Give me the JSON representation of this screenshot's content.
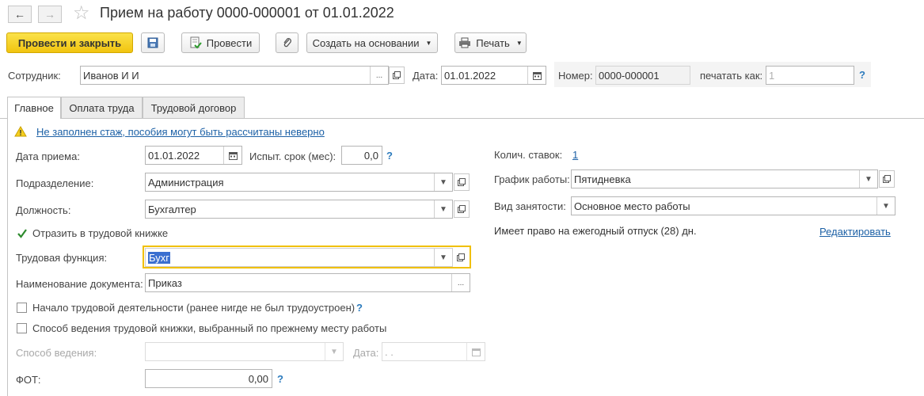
{
  "window": {
    "title": "Прием на работу 0000-000001 от 01.01.2022",
    "back_icon": "←",
    "forward_icon": "→",
    "favorite_icon": "☆"
  },
  "toolbar": {
    "post_and_close": "Провести и закрыть",
    "post": "Провести",
    "create_based_on": "Создать на основании",
    "print": "Печать"
  },
  "header": {
    "employee_label": "Сотрудник:",
    "employee_value": "Иванов И И",
    "date_label": "Дата:",
    "date_value": "01.01.2022",
    "number_label": "Номер:",
    "number_value": "0000-000001",
    "print_as_label": "печатать как:",
    "print_as_placeholder": "1",
    "help": "?"
  },
  "tabs": [
    {
      "label": "Главное"
    },
    {
      "label": "Оплата труда"
    },
    {
      "label": "Трудовой договор"
    }
  ],
  "main": {
    "warning_text": "Не заполнен стаж, пособия могут быть рассчитаны неверно",
    "hire_date_label": "Дата приема:",
    "hire_date_value": "01.01.2022",
    "probation_label": "Испыт. срок (мес):",
    "probation_value": "0,0",
    "department_label": "Подразделение:",
    "department_value": "Администрация",
    "position_label": "Должность:",
    "position_value": "Бухгалтер",
    "workbook_label": "Отразить в трудовой книжке",
    "labor_function_label": "Трудовая функция:",
    "labor_function_value": "Бухг",
    "doc_name_label": "Наименование документа:",
    "doc_name_value": "Приказ",
    "start_activity_label": "Начало трудовой деятельности (ранее нигде не был трудоустроен)",
    "workbook_method_label": "Способ ведения трудовой книжки, выбранный по прежнему месту работы",
    "method_label": "Способ ведения:",
    "method_date_label": "Дата:",
    "method_date_value": ". .",
    "fot_label": "ФОТ:",
    "fot_value": "0,00",
    "help": "?"
  },
  "right": {
    "rates_label": "Колич. ставок:",
    "rates_value": "1",
    "schedule_label": "График работы:",
    "schedule_value": "Пятидневка",
    "employment_label": "Вид занятости:",
    "employment_value": "Основное место работы",
    "vacation_text": "Имеет право на ежегодный отпуск (28) дн.",
    "edit_link": "Редактировать"
  },
  "colors": {
    "accent_yellow": "#f5cf1f",
    "link_blue": "#1d61a6",
    "help_blue": "#2c7bbd",
    "selection_blue": "#3a6fd0",
    "focus_border": "#f0c000"
  }
}
